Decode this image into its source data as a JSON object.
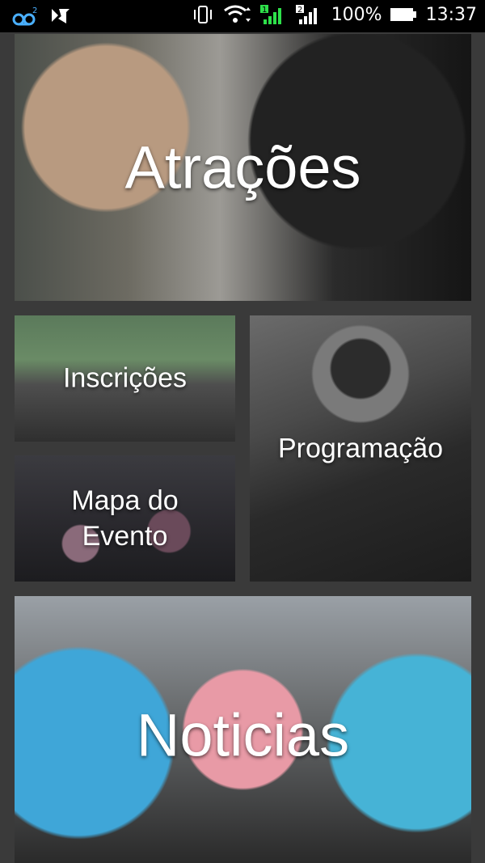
{
  "status_bar": {
    "battery_percent": "100%",
    "time": "13:37",
    "sim1": "1",
    "sim2": "2",
    "voicemail_badge": "2"
  },
  "tiles": {
    "atracoes": "Atrações",
    "inscricoes": "Inscrições",
    "mapa_do_evento": "Mapa do\nEvento",
    "programacao": "Programação",
    "noticias": "Noticias"
  }
}
